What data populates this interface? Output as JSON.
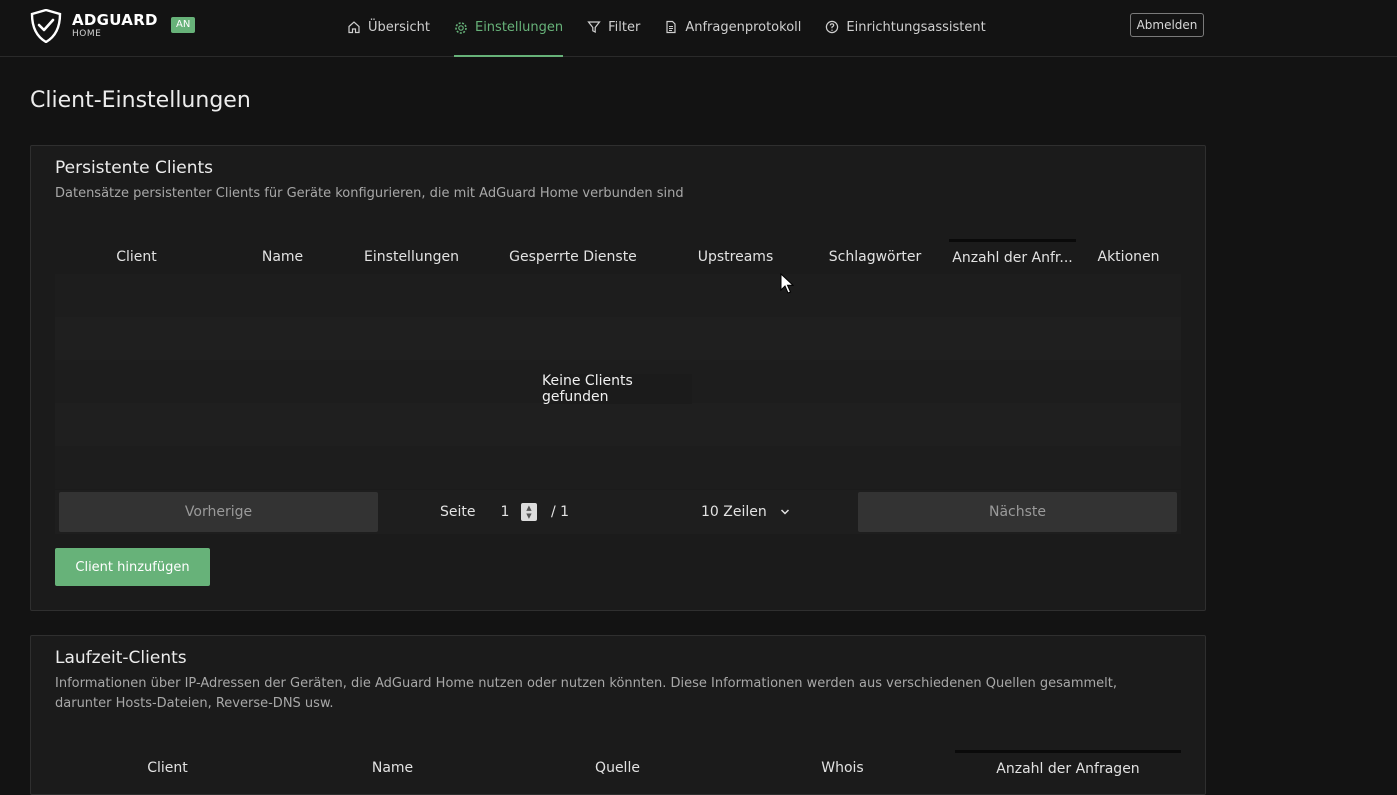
{
  "header": {
    "logo_name": "ADGUARD",
    "logo_sub": "HOME",
    "status_badge": "AN",
    "logout_label": "Abmelden",
    "nav": [
      {
        "label": "Übersicht",
        "icon": "home-icon"
      },
      {
        "label": "Einstellungen",
        "icon": "gear-icon",
        "active": true
      },
      {
        "label": "Filter",
        "icon": "filter-icon"
      },
      {
        "label": "Anfragenprotokoll",
        "icon": "document-icon"
      },
      {
        "label": "Einrichtungsassistent",
        "icon": "help-circle-icon"
      }
    ]
  },
  "page": {
    "title": "Client-Einstellungen"
  },
  "persistent": {
    "title": "Persistente Clients",
    "subtitle": "Datensätze persistenter Clients für Geräte konfigurieren, die mit AdGuard Home verbunden sind",
    "columns": [
      "Client",
      "Name",
      "Einstellungen",
      "Gesperrte Dienste",
      "Upstreams",
      "Schlagwörter",
      "Anzahl der Anfr...",
      "Aktionen"
    ],
    "empty_message": "Keine Clients gefunden",
    "pagination": {
      "prev_label": "Vorherige",
      "next_label": "Nächste",
      "page_label": "Seite",
      "page_value": "1",
      "page_total": "/ 1",
      "rows_label": "10 Zeilen"
    },
    "add_label": "Client hinzufügen"
  },
  "runtime": {
    "title": "Laufzeit-Clients",
    "subtitle": "Informationen über IP-Adressen der Geräten, die AdGuard Home nutzen oder nutzen könnten. Diese Informationen werden aus verschiedenen Quellen gesammelt, darunter Hosts-Dateien, Reverse-DNS usw.",
    "columns": [
      "Client",
      "Name",
      "Quelle",
      "Whois",
      "Anzahl der Anfragen"
    ]
  },
  "colors": {
    "accent": "#67b279",
    "background": "#131313",
    "card": "#1b1b1b"
  }
}
